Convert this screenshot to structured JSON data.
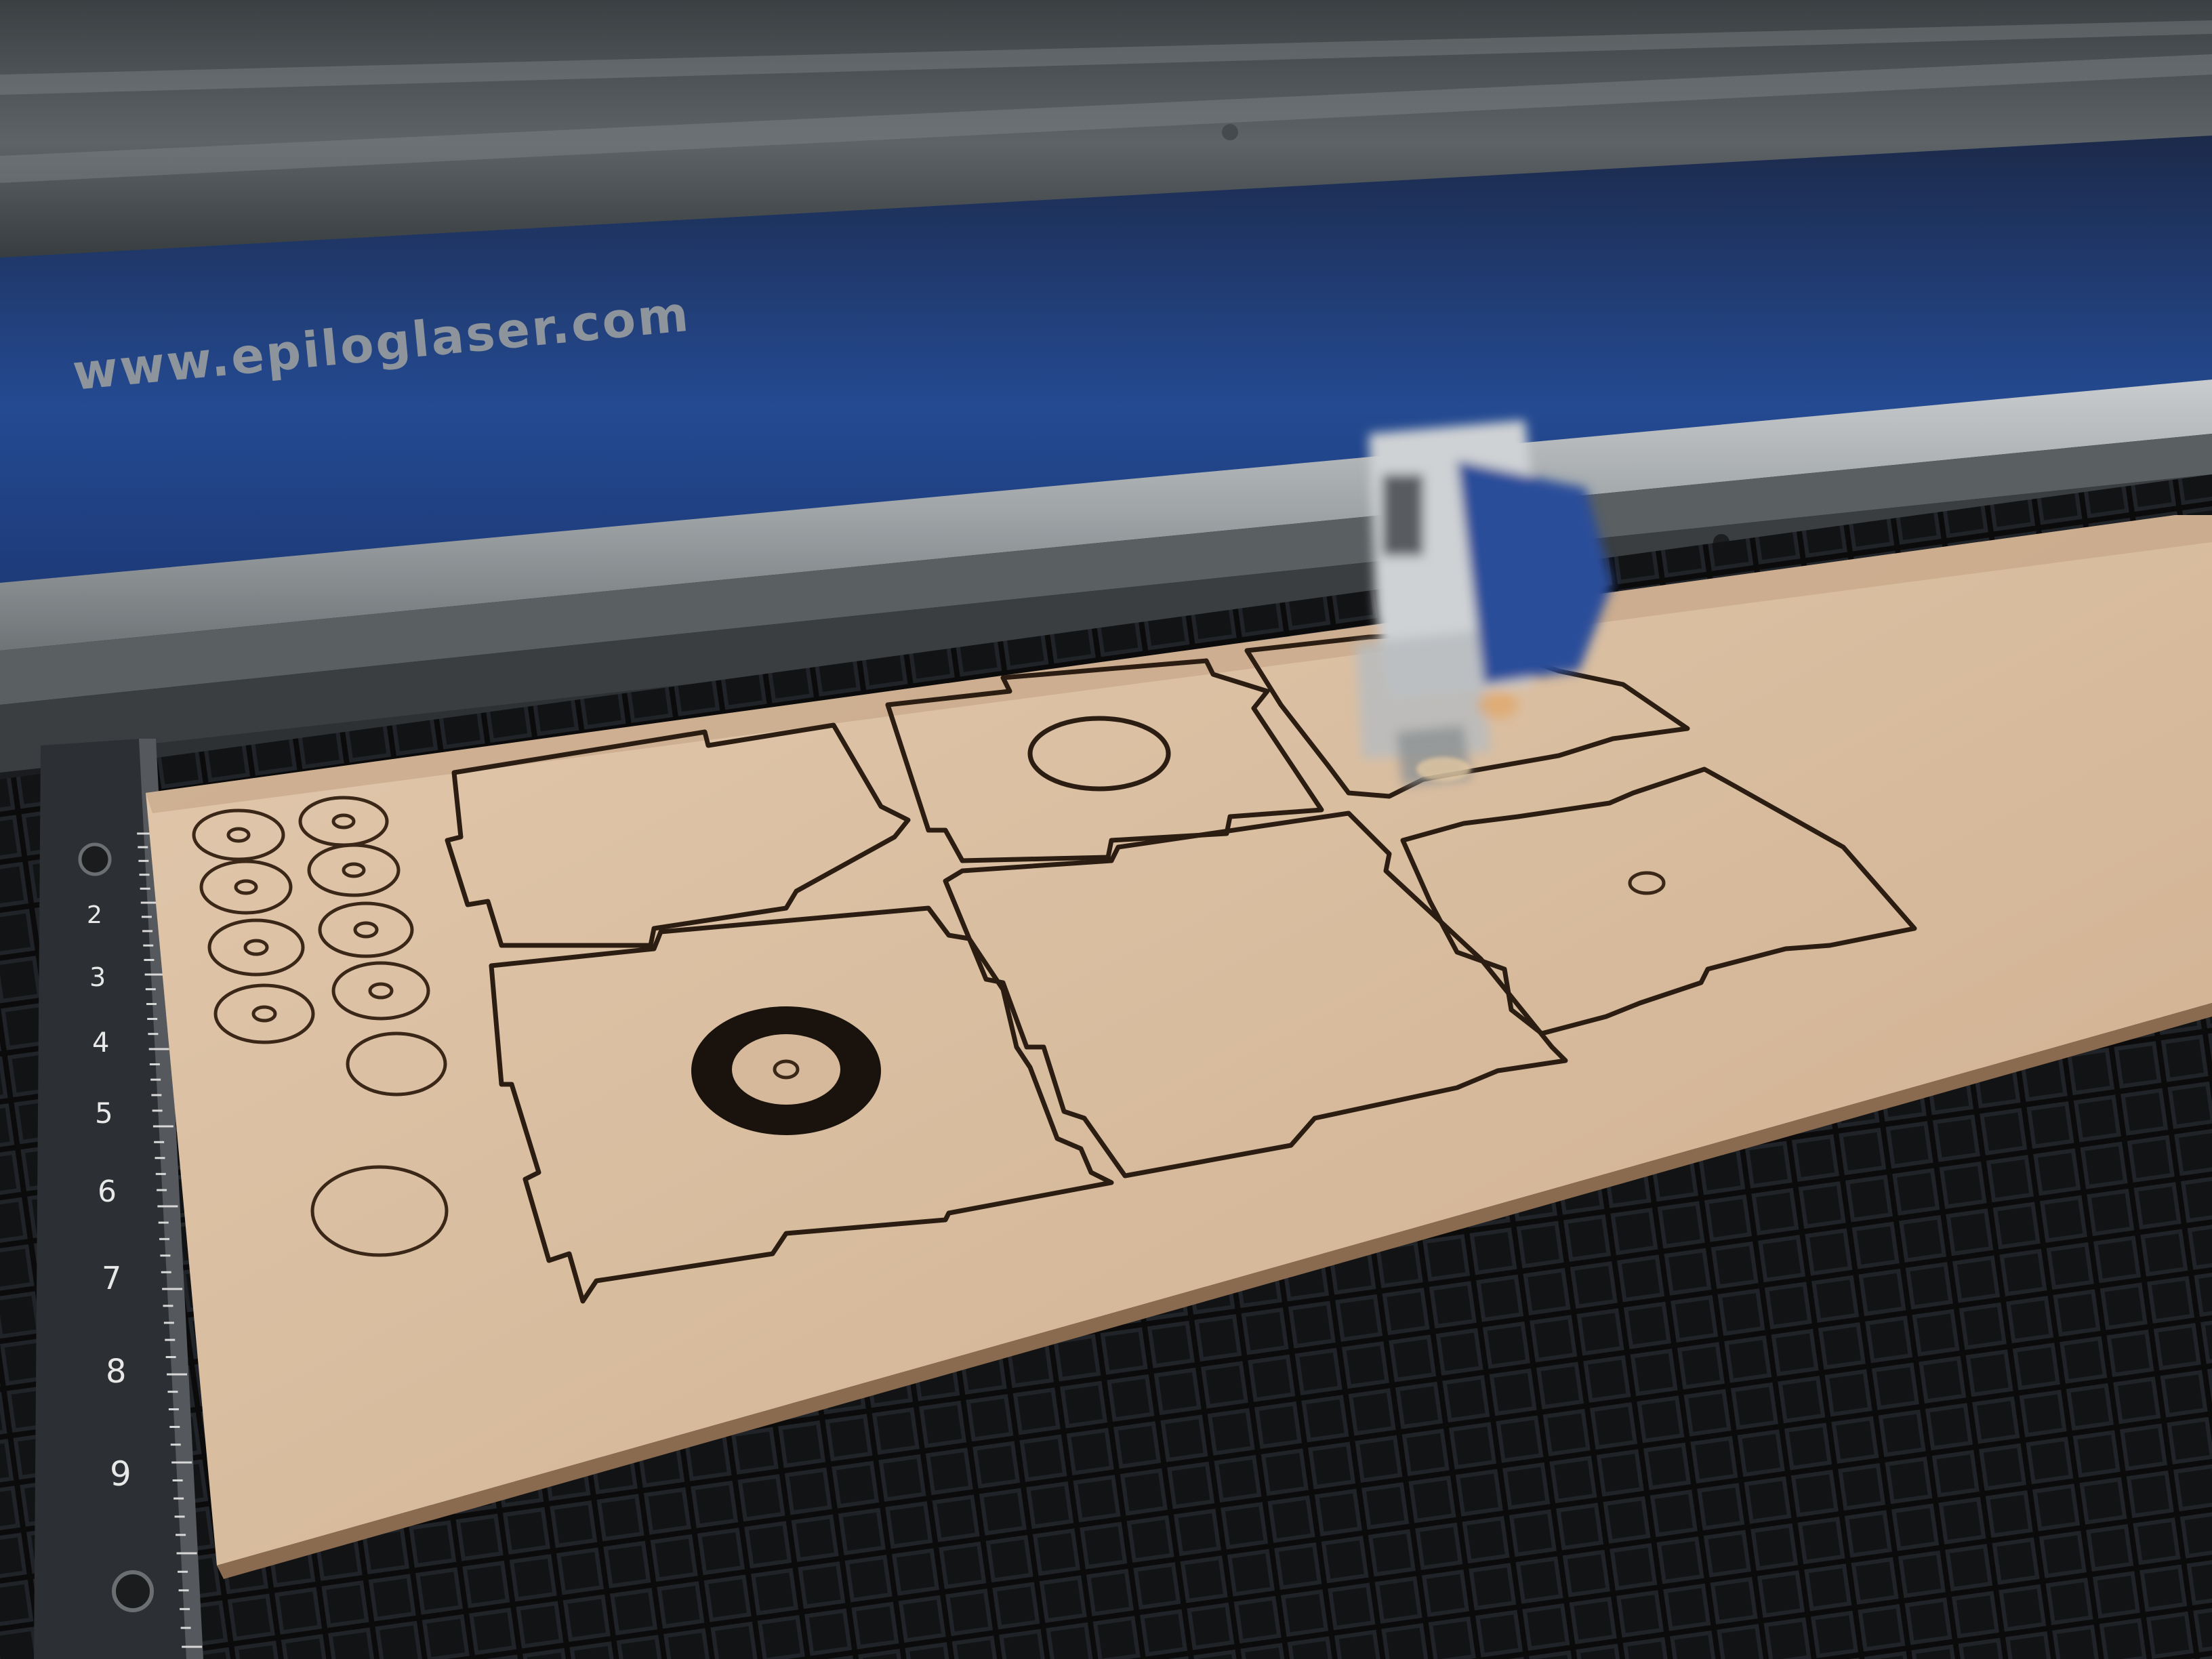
{
  "scene": {
    "subject": "laser cutter bed with plywood sheet",
    "colors": {
      "gantry_blue": "#1f3f86",
      "plywood": "#d9bfa3",
      "cut_line": "#2b1d12",
      "honeycomb_bg": "#0c0c0d",
      "honeycomb_cell": "#2a2d31",
      "ruler": "#2c2f33"
    }
  },
  "machine": {
    "brand_text": "www.epiloglaser.com"
  },
  "ruler": {
    "ticks": [
      "2",
      "3",
      "4",
      "5",
      "6",
      "7",
      "8",
      "9"
    ]
  },
  "icons": {
    "laser_head": "laser-head-icon",
    "screw": "screw-icon"
  }
}
